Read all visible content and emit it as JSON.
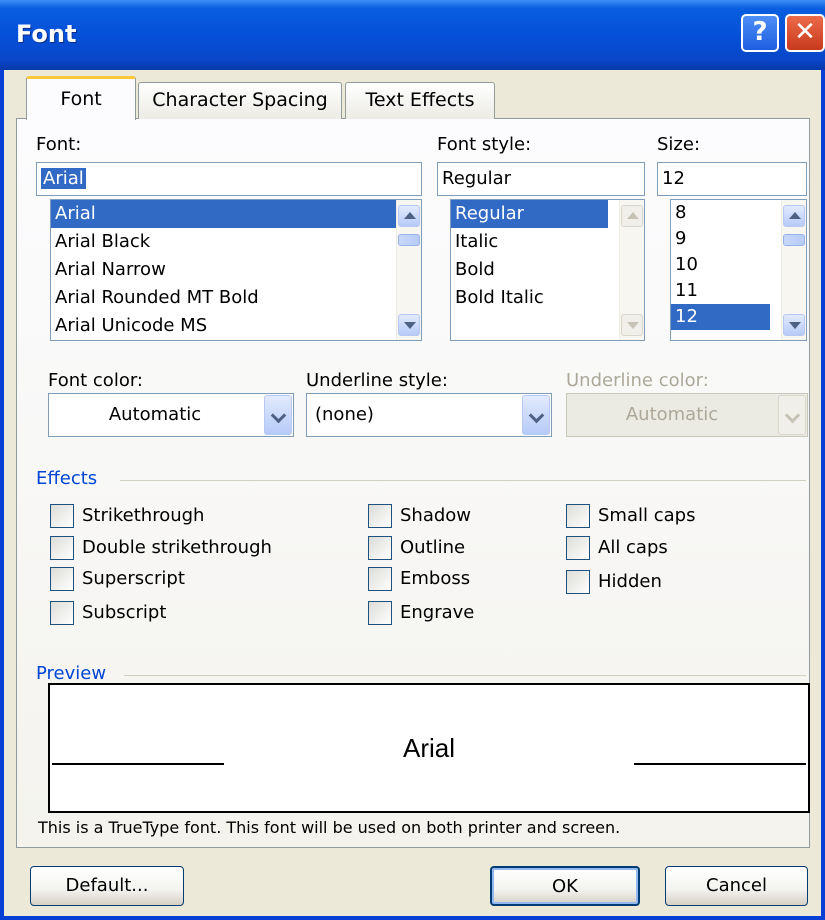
{
  "window": {
    "title": "Font",
    "help_glyph": "?",
    "close_glyph": "✕"
  },
  "tabs": [
    {
      "label": "Font",
      "active": true
    },
    {
      "label": "Character Spacing",
      "active": false
    },
    {
      "label": "Text Effects",
      "active": false
    }
  ],
  "font": {
    "label": "Font:",
    "value": "Arial",
    "items": [
      "Arial",
      "Arial Black",
      "Arial Narrow",
      "Arial Rounded MT Bold",
      "Arial Unicode MS"
    ],
    "selected": "Arial"
  },
  "font_style": {
    "label": "Font style:",
    "value": "Regular",
    "items": [
      "Regular",
      "Italic",
      "Bold",
      "Bold Italic"
    ],
    "selected": "Regular"
  },
  "size": {
    "label": "Size:",
    "value": "12",
    "items": [
      "8",
      "9",
      "10",
      "11",
      "12"
    ],
    "selected": "12"
  },
  "font_color": {
    "label": "Font color:",
    "value": "Automatic"
  },
  "underline_style": {
    "label": "Underline style:",
    "value": "(none)"
  },
  "underline_color": {
    "label": "Underline color:",
    "value": "Automatic",
    "disabled": true
  },
  "effects": {
    "title": "Effects",
    "col1": [
      "Strikethrough",
      "Double strikethrough",
      "Superscript",
      "Subscript"
    ],
    "col2": [
      "Shadow",
      "Outline",
      "Emboss",
      "Engrave"
    ],
    "col3": [
      "Small caps",
      "All caps",
      "Hidden"
    ]
  },
  "preview": {
    "title": "Preview",
    "sample": "Arial",
    "note": "This is a TrueType font. This font will be used on both printer and screen."
  },
  "buttons": {
    "default": "Default...",
    "ok": "OK",
    "cancel": "Cancel"
  },
  "colors": {
    "title_bar": "#0550d8",
    "selection": "#316ac5",
    "group_title": "#0046d5",
    "dialog_bg": "#ece9d8"
  }
}
